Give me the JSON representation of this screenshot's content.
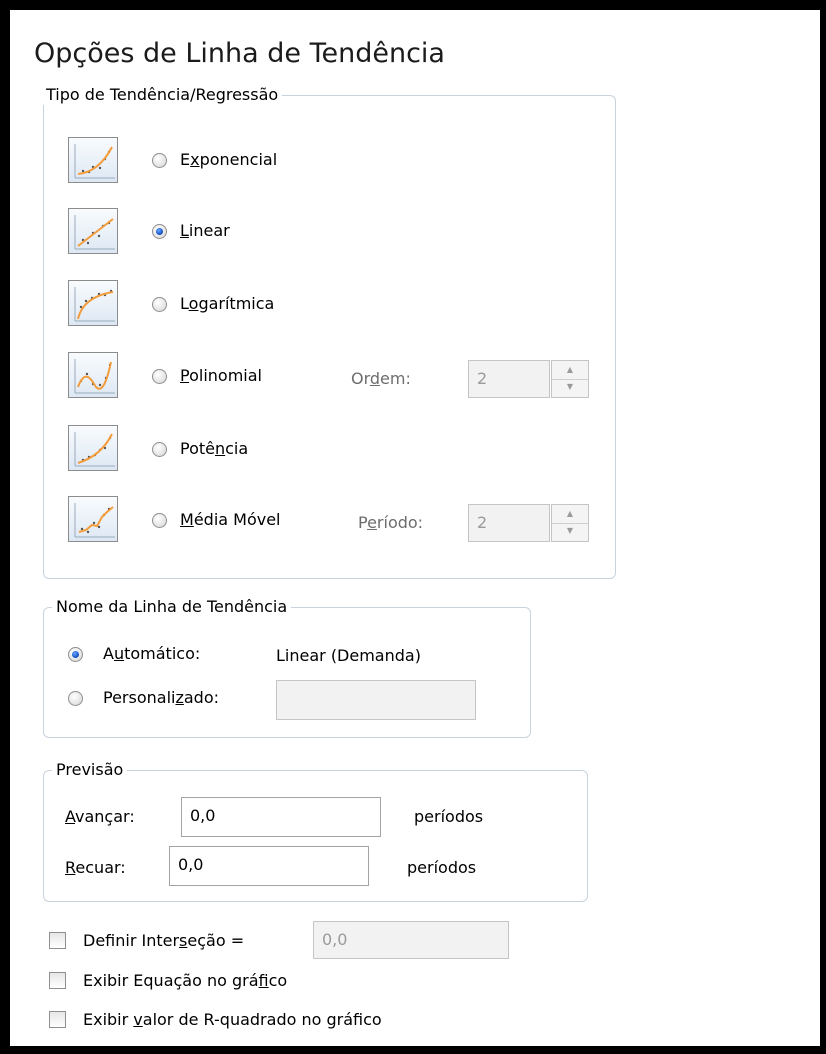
{
  "dialog": {
    "title": "Opções de Linha de Tendência"
  },
  "trend_type": {
    "legend": "Tipo de Tendência/Regressão",
    "options": [
      {
        "label": "Exponencial",
        "selected": false,
        "icon": "exponential-trend-icon"
      },
      {
        "label": "Linear",
        "selected": true,
        "icon": "linear-trend-icon"
      },
      {
        "label": "Logarítmica",
        "selected": false,
        "icon": "logarithmic-trend-icon"
      },
      {
        "label": "Polinomial",
        "selected": false,
        "icon": "polynomial-trend-icon"
      },
      {
        "label": "Potência",
        "selected": false,
        "icon": "power-trend-icon"
      },
      {
        "label": "Média Móvel",
        "selected": false,
        "icon": "moving-average-trend-icon"
      }
    ],
    "order": {
      "label": "Ordem:",
      "value": "2"
    },
    "period": {
      "label": "Período:",
      "value": "2"
    }
  },
  "trendline_name": {
    "legend": "Nome da Linha de Tendência",
    "automatic": {
      "label": "Automático:",
      "value": "Linear (Demanda)",
      "selected": true
    },
    "custom": {
      "label": "Personalizado:",
      "value": "",
      "selected": false
    }
  },
  "forecast": {
    "legend": "Previsão",
    "forward": {
      "label": "Avançar:",
      "value": "0,0",
      "unit": "períodos"
    },
    "backward": {
      "label": "Recuar:",
      "value": "0,0",
      "unit": "períodos"
    }
  },
  "intercept": {
    "label": "Definir Interseção =",
    "value": "0,0",
    "checked": false
  },
  "display_equation": {
    "label": "Exibir Equação no gráfico",
    "checked": false
  },
  "display_r2": {
    "label": "Exibir valor de R-quadrado no gráfico",
    "checked": false
  },
  "colors": {
    "trend_line": "#f39c3b",
    "radio_selected": "#1a57c8",
    "group_border": "#c9d3de"
  }
}
